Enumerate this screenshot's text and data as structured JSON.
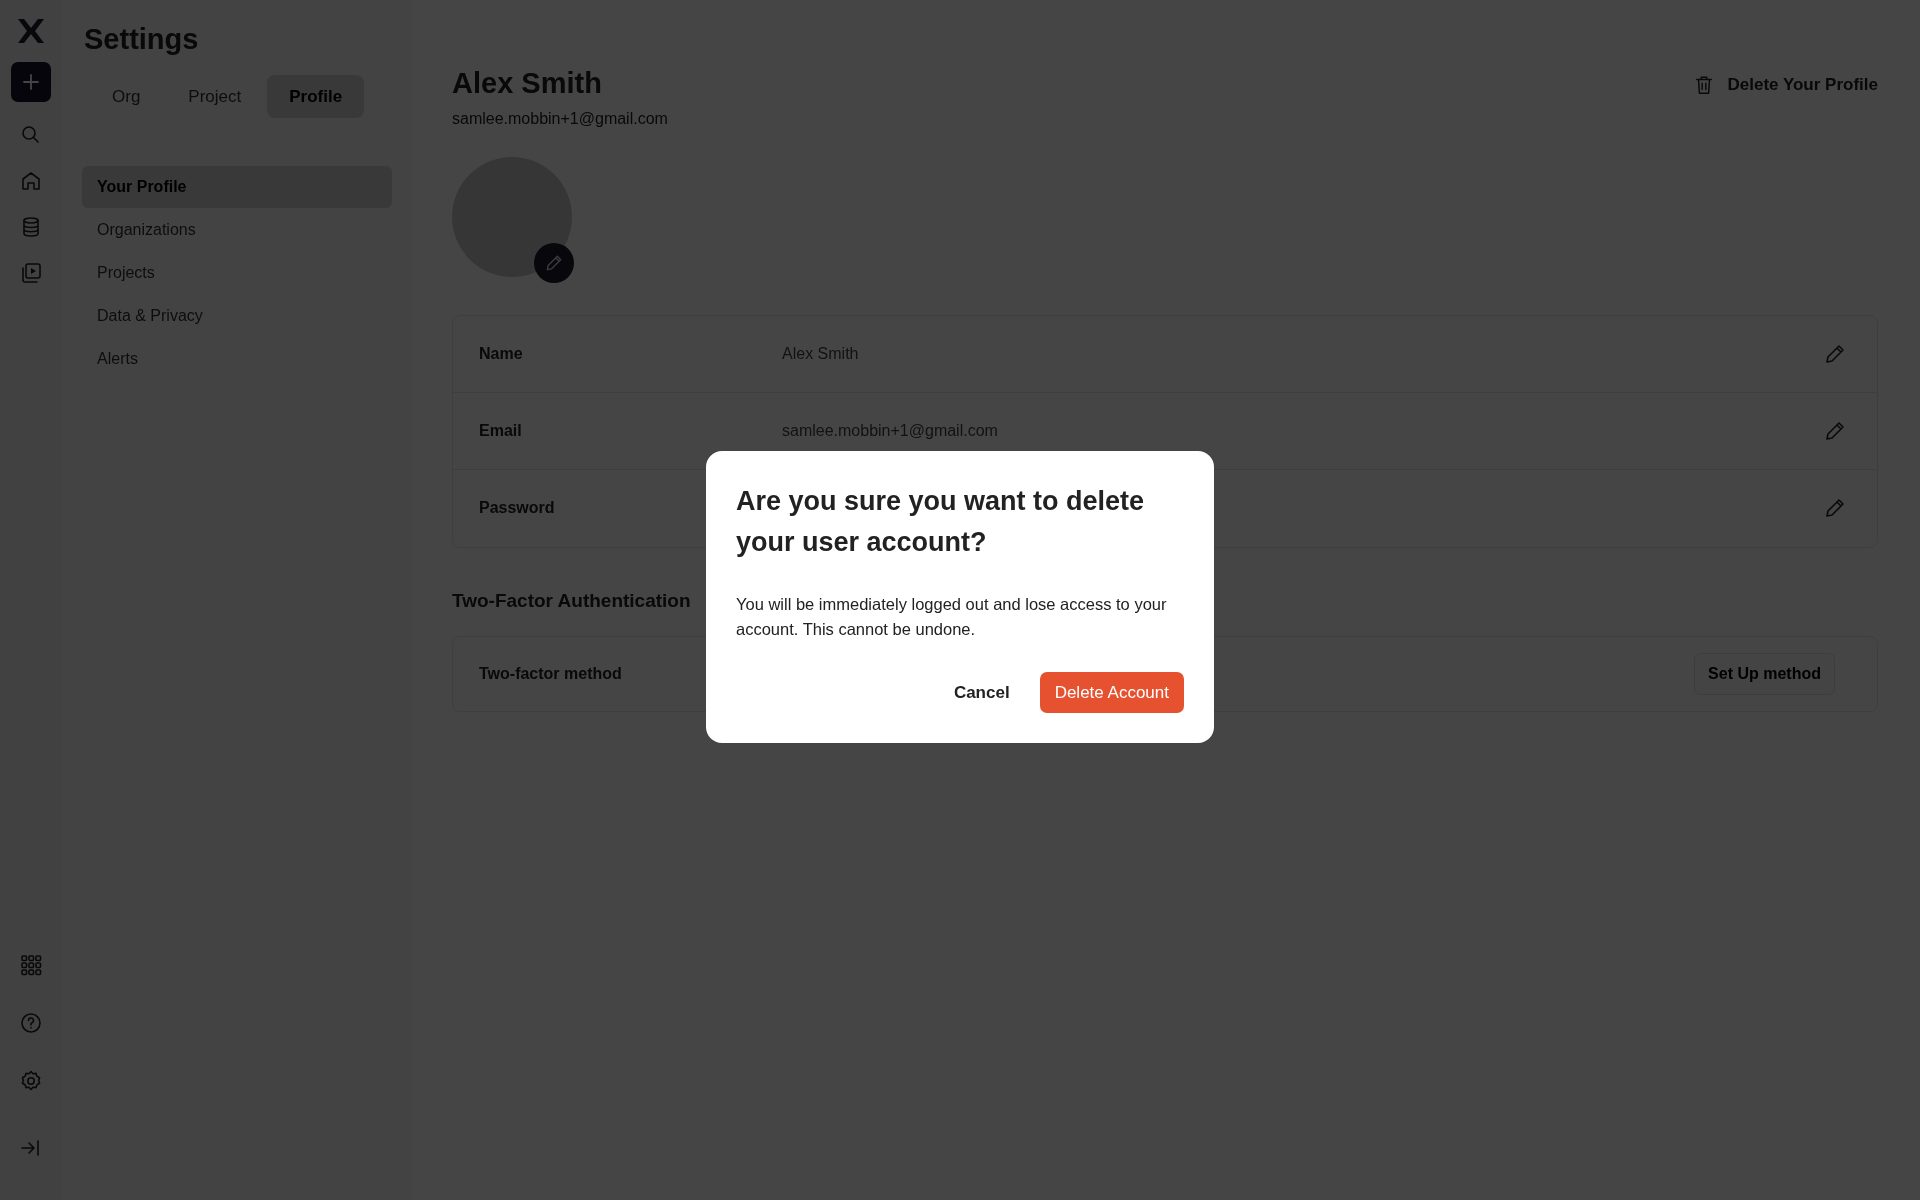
{
  "settings": {
    "title": "Settings",
    "tabs": [
      {
        "label": "Org",
        "selected": false
      },
      {
        "label": "Project",
        "selected": false
      },
      {
        "label": "Profile",
        "selected": true
      }
    ],
    "items": [
      {
        "label": "Your Profile",
        "selected": true
      },
      {
        "label": "Organizations",
        "selected": false
      },
      {
        "label": "Projects",
        "selected": false
      },
      {
        "label": "Data & Privacy",
        "selected": false
      },
      {
        "label": "Alerts",
        "selected": false
      }
    ]
  },
  "profile": {
    "name": "Alex Smith",
    "email": "samlee.mobbin+1@gmail.com",
    "delete_link": "Delete Your Profile",
    "fields": [
      {
        "label": "Name",
        "value": "Alex Smith"
      },
      {
        "label": "Email",
        "value": "samlee.mobbin+1@gmail.com"
      },
      {
        "label": "Password"
      }
    ],
    "two_factor": {
      "heading": "Two-Factor Authentication",
      "label": "Two-factor method",
      "button": "Set Up method"
    }
  },
  "dialog": {
    "title": "Are you sure you want to delete your user account?",
    "message": "You will be immediately logged out and lose access to your account. This cannot be undone.",
    "cancel": "Cancel",
    "confirm": "Delete Account"
  }
}
